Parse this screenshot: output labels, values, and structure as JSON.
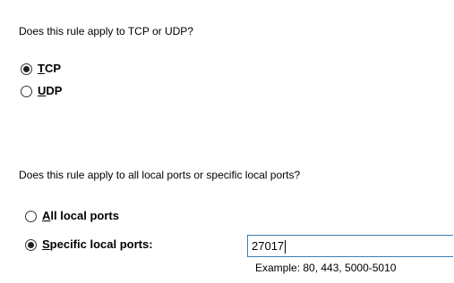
{
  "protocol_section": {
    "question": "Does this rule apply to TCP or UDP?",
    "options": [
      {
        "mnemonic": "T",
        "rest": "CP",
        "selected": true
      },
      {
        "mnemonic": "U",
        "rest": "DP",
        "selected": false
      }
    ]
  },
  "ports_section": {
    "question": "Does this rule apply to all local ports or specific local ports?",
    "options": [
      {
        "mnemonic": "A",
        "rest": "ll local ports",
        "selected": false
      },
      {
        "mnemonic": "S",
        "rest": "pecific local ports:",
        "selected": true
      }
    ],
    "input_value": "27017",
    "example_text": "Example: 80, 443, 5000-5010"
  }
}
